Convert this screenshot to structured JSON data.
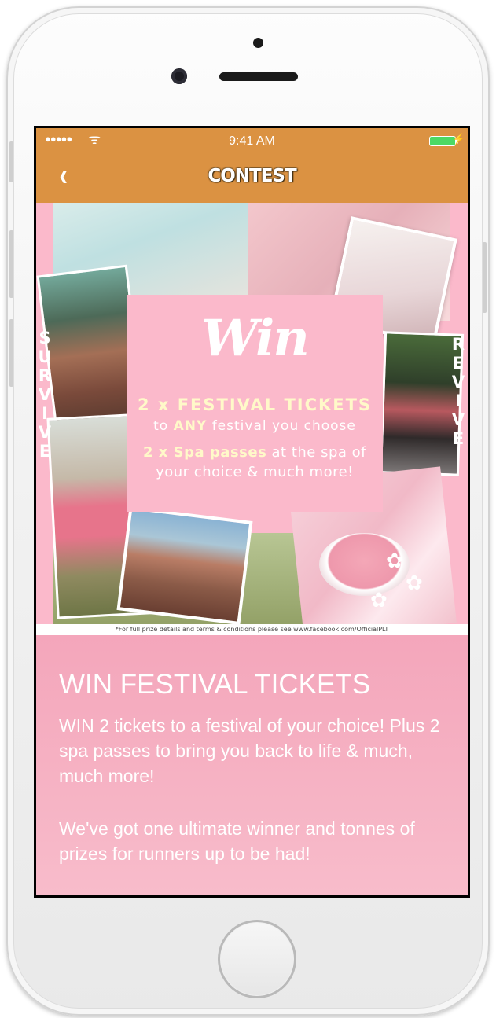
{
  "status_bar": {
    "signal": "●●●●●",
    "wifi": "ᯤ",
    "time": "9:41 AM",
    "charging": "⚡"
  },
  "nav": {
    "back_icon": "‹",
    "title": "CONTEST"
  },
  "promo": {
    "left_vertical": [
      "S",
      "U",
      "R",
      "V",
      "I",
      "V",
      "E"
    ],
    "right_vertical": [
      "R",
      "E",
      "V",
      "I",
      "V",
      "E"
    ],
    "win_word": "Win",
    "line1": "2 x FESTIVAL TICKETS",
    "line2_pre": "to ",
    "line2_highlight": "ANY",
    "line2_post": " festival you choose",
    "line3_highlight": "2 x Spa passes",
    "line3_post": " at the spa of",
    "line4": "your choice & much more!",
    "footnote": "*For full prize details and terms & conditions please see www.facebook.com/OfficialPLT"
  },
  "content": {
    "heading": "WIN FESTIVAL TICKETS",
    "paragraph1": "WIN 2 tickets to a festival of your choice! Plus 2 spa passes to bring you back to life & much, much more!",
    "paragraph2": "We've got one ultimate winner and tonnes of prizes for runners up to be had!"
  },
  "colors": {
    "nav_bar": "#db9242",
    "promo_pink": "#fbb9cb",
    "highlight_yellow": "#fff9c9",
    "battery_green": "#4cd964"
  }
}
